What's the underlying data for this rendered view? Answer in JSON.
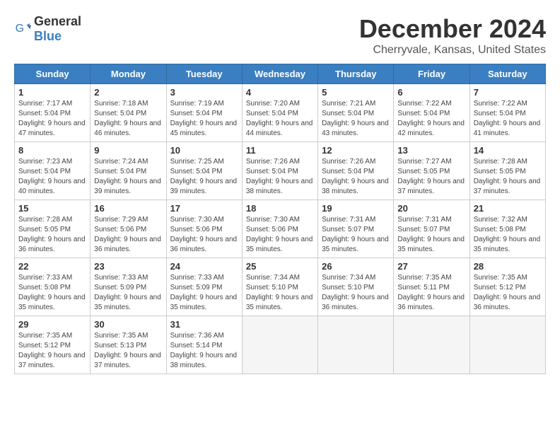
{
  "logo": {
    "general": "General",
    "blue": "Blue"
  },
  "title": "December 2024",
  "location": "Cherryvale, Kansas, United States",
  "days_of_week": [
    "Sunday",
    "Monday",
    "Tuesday",
    "Wednesday",
    "Thursday",
    "Friday",
    "Saturday"
  ],
  "weeks": [
    [
      {
        "day": "1",
        "sunrise": "7:17 AM",
        "sunset": "5:04 PM",
        "daylight": "9 hours and 47 minutes."
      },
      {
        "day": "2",
        "sunrise": "7:18 AM",
        "sunset": "5:04 PM",
        "daylight": "9 hours and 46 minutes."
      },
      {
        "day": "3",
        "sunrise": "7:19 AM",
        "sunset": "5:04 PM",
        "daylight": "9 hours and 45 minutes."
      },
      {
        "day": "4",
        "sunrise": "7:20 AM",
        "sunset": "5:04 PM",
        "daylight": "9 hours and 44 minutes."
      },
      {
        "day": "5",
        "sunrise": "7:21 AM",
        "sunset": "5:04 PM",
        "daylight": "9 hours and 43 minutes."
      },
      {
        "day": "6",
        "sunrise": "7:22 AM",
        "sunset": "5:04 PM",
        "daylight": "9 hours and 42 minutes."
      },
      {
        "day": "7",
        "sunrise": "7:22 AM",
        "sunset": "5:04 PM",
        "daylight": "9 hours and 41 minutes."
      }
    ],
    [
      {
        "day": "8",
        "sunrise": "7:23 AM",
        "sunset": "5:04 PM",
        "daylight": "9 hours and 40 minutes."
      },
      {
        "day": "9",
        "sunrise": "7:24 AM",
        "sunset": "5:04 PM",
        "daylight": "9 hours and 39 minutes."
      },
      {
        "day": "10",
        "sunrise": "7:25 AM",
        "sunset": "5:04 PM",
        "daylight": "9 hours and 39 minutes."
      },
      {
        "day": "11",
        "sunrise": "7:26 AM",
        "sunset": "5:04 PM",
        "daylight": "9 hours and 38 minutes."
      },
      {
        "day": "12",
        "sunrise": "7:26 AM",
        "sunset": "5:04 PM",
        "daylight": "9 hours and 38 minutes."
      },
      {
        "day": "13",
        "sunrise": "7:27 AM",
        "sunset": "5:05 PM",
        "daylight": "9 hours and 37 minutes."
      },
      {
        "day": "14",
        "sunrise": "7:28 AM",
        "sunset": "5:05 PM",
        "daylight": "9 hours and 37 minutes."
      }
    ],
    [
      {
        "day": "15",
        "sunrise": "7:28 AM",
        "sunset": "5:05 PM",
        "daylight": "9 hours and 36 minutes."
      },
      {
        "day": "16",
        "sunrise": "7:29 AM",
        "sunset": "5:06 PM",
        "daylight": "9 hours and 36 minutes."
      },
      {
        "day": "17",
        "sunrise": "7:30 AM",
        "sunset": "5:06 PM",
        "daylight": "9 hours and 36 minutes."
      },
      {
        "day": "18",
        "sunrise": "7:30 AM",
        "sunset": "5:06 PM",
        "daylight": "9 hours and 35 minutes."
      },
      {
        "day": "19",
        "sunrise": "7:31 AM",
        "sunset": "5:07 PM",
        "daylight": "9 hours and 35 minutes."
      },
      {
        "day": "20",
        "sunrise": "7:31 AM",
        "sunset": "5:07 PM",
        "daylight": "9 hours and 35 minutes."
      },
      {
        "day": "21",
        "sunrise": "7:32 AM",
        "sunset": "5:08 PM",
        "daylight": "9 hours and 35 minutes."
      }
    ],
    [
      {
        "day": "22",
        "sunrise": "7:33 AM",
        "sunset": "5:08 PM",
        "daylight": "9 hours and 35 minutes."
      },
      {
        "day": "23",
        "sunrise": "7:33 AM",
        "sunset": "5:09 PM",
        "daylight": "9 hours and 35 minutes."
      },
      {
        "day": "24",
        "sunrise": "7:33 AM",
        "sunset": "5:09 PM",
        "daylight": "9 hours and 35 minutes."
      },
      {
        "day": "25",
        "sunrise": "7:34 AM",
        "sunset": "5:10 PM",
        "daylight": "9 hours and 35 minutes."
      },
      {
        "day": "26",
        "sunrise": "7:34 AM",
        "sunset": "5:10 PM",
        "daylight": "9 hours and 36 minutes."
      },
      {
        "day": "27",
        "sunrise": "7:35 AM",
        "sunset": "5:11 PM",
        "daylight": "9 hours and 36 minutes."
      },
      {
        "day": "28",
        "sunrise": "7:35 AM",
        "sunset": "5:12 PM",
        "daylight": "9 hours and 36 minutes."
      }
    ],
    [
      {
        "day": "29",
        "sunrise": "7:35 AM",
        "sunset": "5:12 PM",
        "daylight": "9 hours and 37 minutes."
      },
      {
        "day": "30",
        "sunrise": "7:35 AM",
        "sunset": "5:13 PM",
        "daylight": "9 hours and 37 minutes."
      },
      {
        "day": "31",
        "sunrise": "7:36 AM",
        "sunset": "5:14 PM",
        "daylight": "9 hours and 38 minutes."
      },
      null,
      null,
      null,
      null
    ]
  ]
}
